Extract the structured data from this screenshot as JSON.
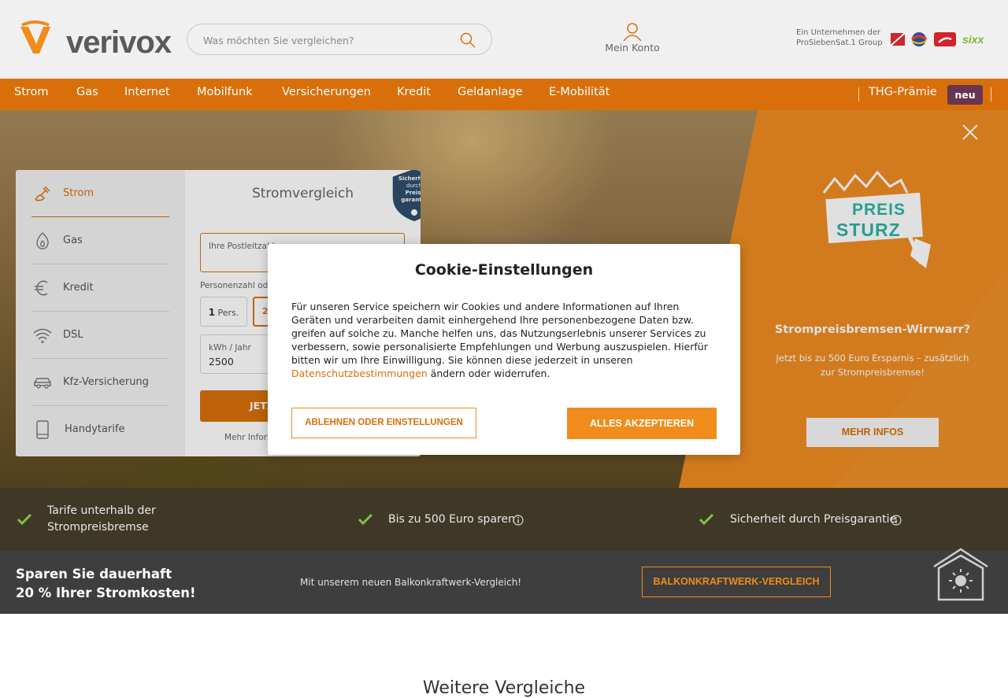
{
  "header": {
    "logo_text": "verivox",
    "search_placeholder": "Was möchten Sie vergleichen?",
    "account_label": "Mein Konto",
    "prosieben_text": "Ein Unternehmen der ProSiebenSat.1 Group"
  },
  "nav": {
    "items": [
      "Strom",
      "Gas",
      "Internet",
      "Mobilfunk",
      "Versicherungen",
      "Kredit",
      "Geldanlage",
      "E-Mobilität"
    ],
    "thg_label": "THG-Prämie",
    "thg_badge": "neu"
  },
  "promo": {
    "logo_line1": "PREIS",
    "logo_line2": "STURZ",
    "title": "Strompreisbremsen-Wirrwarr?",
    "text": "Jetzt bis zu 500 Euro Ersparnis – zusätzlich zur Strompreisbremse!",
    "button": "MEHR INFOS"
  },
  "calculator": {
    "side_items": [
      "Strom",
      "Gas",
      "Kredit",
      "DSL",
      "Kfz-Versicherung",
      "Handytarife"
    ],
    "title": "Stromvergleich",
    "badge_text": [
      "Sicherheit",
      "durch",
      "Preis-",
      "garantie"
    ],
    "plz_label": "Ihre Postleitzahl",
    "persons_label": "Personenzahl oder Verbrauch",
    "person1_num": "1",
    "person1_unit": "Pers.",
    "person2": "2",
    "kwh_label": "kWh / Jahr",
    "kwh_value": "2500",
    "button": "JETZT VERGLEICHEN",
    "more_link": "Mehr Informationen"
  },
  "benefits": [
    {
      "text": "Tarife unterhalb der Strompreisbremse"
    },
    {
      "text": "Bis zu 500 Euro sparen"
    },
    {
      "text": "Sicherheit durch Preisgarantie"
    }
  ],
  "balkon": {
    "title_line1": "Sparen Sie dauerhaft",
    "title_line2": "20 % Ihrer Stromkosten!",
    "text": "Mit unserem neuen Balkonkraftwerk-Vergleich!",
    "button": "BALKONKRAFTWERK-VERGLEICH"
  },
  "section_title": "Weitere Vergleiche",
  "cookie": {
    "title": "Cookie-Einstellungen",
    "text_before_link": "Für unseren Service speichern wir Cookies und andere Informationen auf Ihren Geräten und verarbeiten damit einhergehend Ihre personenbezogene Daten bzw. greifen auf solche zu. Manche helfen uns, das Nutzungserlebnis unserer Services zu verbessern, sowie personalisierte Empfehlungen und Werbung auszuspielen. Hierfür bitten wir um Ihre Einwilligung. Sie können diese jederzeit in unseren ",
    "link": "Datenschutzbestimmungen",
    "text_after_link": " ändern oder widerrufen.",
    "reject_button": "ABLEHNEN ODER EINSTELLUNGEN",
    "accept_button": "ALLES AKZEPTIEREN"
  },
  "colors": {
    "brand_orange": "#d96f0a",
    "accent_orange": "#f08c1c",
    "badge_purple": "#6a3550",
    "check_green": "#7cc242"
  }
}
